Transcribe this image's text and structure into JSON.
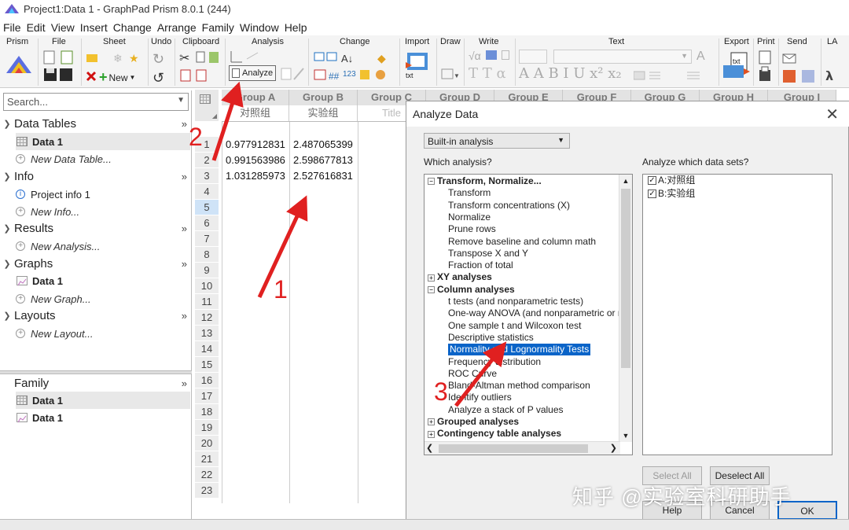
{
  "window": {
    "title": "Project1:Data 1 - GraphPad Prism 8.0.1 (244)"
  },
  "menu": [
    "File",
    "Edit",
    "View",
    "Insert",
    "Change",
    "Arrange",
    "Family",
    "Window",
    "Help"
  ],
  "ribbon": {
    "groups": [
      "Prism",
      "File",
      "Sheet",
      "Undo",
      "Clipboard",
      "Analysis",
      "Change",
      "Import",
      "Draw",
      "Write",
      "Text",
      "Export",
      "Print",
      "Send",
      "LA"
    ],
    "analyze_label": "Analyze",
    "new_label": "New",
    "write_text": "√α",
    "text_glyphs": "A A B I U x² x₂",
    "font_t": "T T α"
  },
  "navigator": {
    "search_placeholder": "Search...",
    "sections": [
      {
        "title": "Data Tables",
        "items": [
          {
            "label": "Data 1",
            "selected": true
          },
          {
            "label": "New Data Table...",
            "new": true
          }
        ]
      },
      {
        "title": "Info",
        "items": [
          {
            "label": "Project info 1"
          },
          {
            "label": "New Info...",
            "new": true
          }
        ]
      },
      {
        "title": "Results",
        "items": [
          {
            "label": "New Analysis...",
            "new": true
          }
        ]
      },
      {
        "title": "Graphs",
        "items": [
          {
            "label": "Data 1"
          },
          {
            "label": "New Graph...",
            "new": true
          }
        ]
      },
      {
        "title": "Layouts",
        "items": [
          {
            "label": "New Layout...",
            "new": true
          }
        ]
      }
    ],
    "family": {
      "title": "Family",
      "items": [
        "Data 1",
        "Data 1"
      ]
    }
  },
  "sheet": {
    "columns": [
      "Group A",
      "Group B",
      "Group C",
      "Group D",
      "Group E",
      "Group F",
      "Group G",
      "Group H",
      "Group I"
    ],
    "sub_headers": [
      "对照组",
      "实验组",
      "Title"
    ],
    "rows": [
      [
        "0.977912831",
        "2.487065399"
      ],
      [
        "0.991563986",
        "2.598677813"
      ],
      [
        "1.031285973",
        "2.527616831"
      ]
    ],
    "row_numbers": [
      "1",
      "2",
      "3",
      "4",
      "5",
      "6",
      "7",
      "8",
      "9",
      "10",
      "11",
      "12",
      "13",
      "14",
      "15",
      "16",
      "17",
      "18",
      "19",
      "20",
      "21",
      "22",
      "23"
    ],
    "selected_row": "5"
  },
  "dialog": {
    "title": "Analyze Data",
    "analysis_type": "Built-in analysis",
    "which_analysis_label": "Which analysis?",
    "which_datasets_label": "Analyze which data sets?",
    "tree": [
      {
        "label": "Transform, Normalize...",
        "level": 0,
        "toggle": "−",
        "bold": true
      },
      {
        "label": "Transform",
        "level": 1
      },
      {
        "label": "Transform concentrations (X)",
        "level": 1
      },
      {
        "label": "Normalize",
        "level": 1
      },
      {
        "label": "Prune rows",
        "level": 1
      },
      {
        "label": "Remove baseline and column math",
        "level": 1
      },
      {
        "label": "Transpose X and Y",
        "level": 1
      },
      {
        "label": "Fraction of total",
        "level": 1
      },
      {
        "label": "XY analyses",
        "level": 0,
        "toggle": "+",
        "bold": true
      },
      {
        "label": "Column analyses",
        "level": 0,
        "toggle": "−",
        "bold": true
      },
      {
        "label": "t tests (and nonparametric tests)",
        "level": 1
      },
      {
        "label": "One-way ANOVA (and nonparametric or mi",
        "level": 1
      },
      {
        "label": "One sample t and Wilcoxon test",
        "level": 1
      },
      {
        "label": "Descriptive statistics",
        "level": 1
      },
      {
        "label": "Normality and Lognormality Tests",
        "level": 1,
        "highlight": true
      },
      {
        "label": "Frequency distribution",
        "level": 1
      },
      {
        "label": "ROC Curve",
        "level": 1
      },
      {
        "label": "Bland-Altman method comparison",
        "level": 1
      },
      {
        "label": "Identify outliers",
        "level": 1
      },
      {
        "label": "Analyze a stack of P values",
        "level": 1
      },
      {
        "label": "Grouped analyses",
        "level": 0,
        "toggle": "+",
        "bold": true
      },
      {
        "label": "Contingency table analyses",
        "level": 0,
        "toggle": "+",
        "bold": true
      }
    ],
    "datasets": [
      {
        "label": "A:对照组",
        "checked": true
      },
      {
        "label": "B:实验组",
        "checked": true
      }
    ],
    "select_all": "Select All",
    "deselect_all": "Deselect All",
    "help": "Help",
    "cancel": "Cancel",
    "ok": "OK"
  },
  "annotations": {
    "numbers": [
      "1",
      "2",
      "3"
    ],
    "color": "#e02020"
  },
  "watermark": "知乎 @实验室科研助手",
  "colors": {
    "highlight": "#0a64c8",
    "selected_row": "#cfe3f7",
    "annotation": "#e02020"
  }
}
